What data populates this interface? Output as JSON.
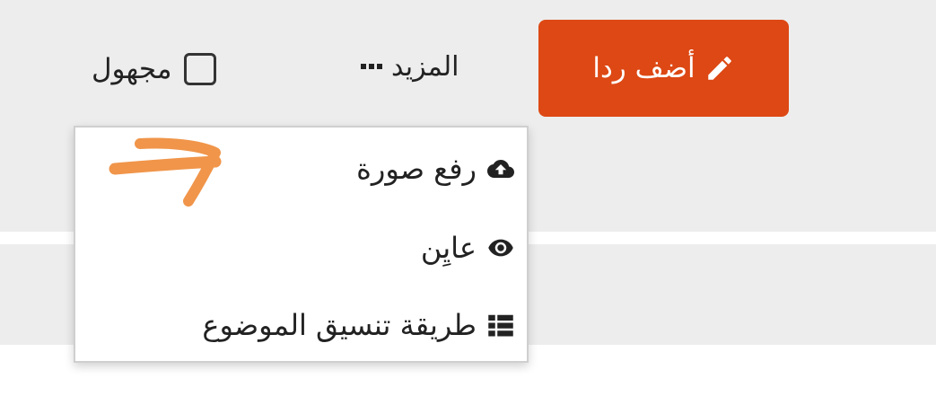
{
  "toolbar": {
    "reply_label": "أضف ردا",
    "more_label": "المزيد",
    "anonymous_label": "مجهول",
    "anonymous_checked": false
  },
  "menu": {
    "items": [
      {
        "label": "رفع صورة",
        "icon": "cloud-upload-icon"
      },
      {
        "label": "عايِن",
        "icon": "eye-icon"
      },
      {
        "label": "طريقة تنسيق الموضوع",
        "icon": "list-icon"
      }
    ]
  },
  "colors": {
    "accent": "#dd4814",
    "annotation": "#f0954a",
    "background": "#ededed"
  }
}
